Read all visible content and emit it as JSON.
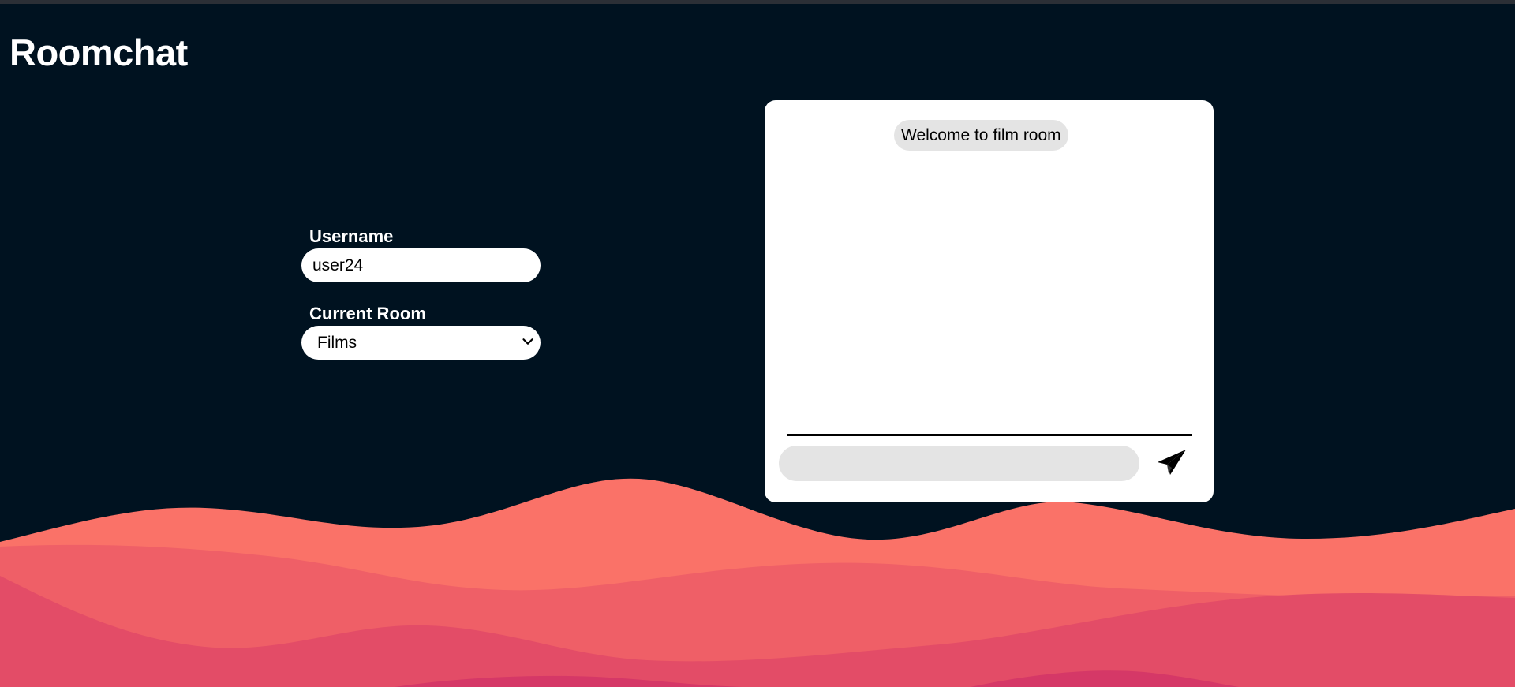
{
  "app": {
    "title": "Roomchat"
  },
  "form": {
    "username_label": "Username",
    "username_value": "user24",
    "room_label": "Current Room",
    "room_selected": "Films"
  },
  "chat": {
    "welcome_message": "Welcome to film room",
    "message_placeholder": ""
  },
  "icons": {
    "send": "paper-plane-icon",
    "select": "chevron-down-icon"
  },
  "colors": {
    "background": "#001220",
    "wave_1": "#fa7268",
    "wave_2": "#ef5f67",
    "wave_3": "#e34c67",
    "wave_4": "#d53867",
    "card": "#ffffff",
    "bubble": "#e4e4e4"
  }
}
